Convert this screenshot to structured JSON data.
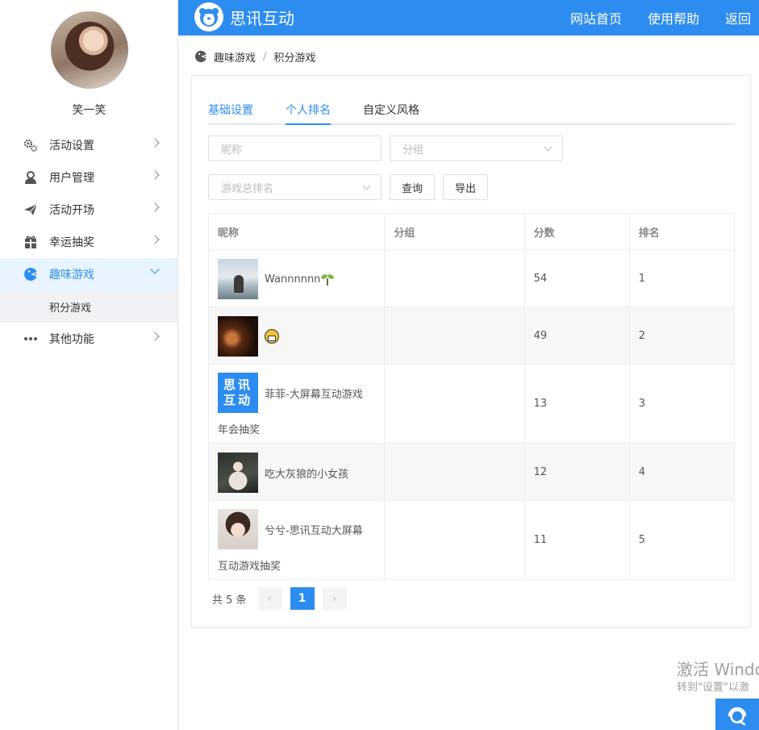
{
  "sidebar": {
    "username": "笑一笑",
    "menu": [
      {
        "label": "活动设置",
        "icon": "gears-icon"
      },
      {
        "label": "用户管理",
        "icon": "user-icon"
      },
      {
        "label": "活动开场",
        "icon": "paper-plane-icon"
      },
      {
        "label": "幸运抽奖",
        "icon": "gift-icon"
      },
      {
        "label": "趣味游戏",
        "icon": "game-icon"
      },
      {
        "label": "其他功能",
        "icon": "more-icon"
      }
    ],
    "submenu_active": "积分游戏"
  },
  "topbar": {
    "brand": "思讯互动",
    "nav": [
      "网站首页",
      "使用帮助",
      "返回"
    ],
    "accent": "#2d8cf0"
  },
  "breadcrumb": [
    "趣味游戏",
    "/",
    "积分游戏"
  ],
  "tabs": [
    "基础设置",
    "个人排名",
    "自定义风格"
  ],
  "filters": {
    "nickname_placeholder": "昵称",
    "group_placeholder": "分组",
    "rank_placeholder": "游戏总排名",
    "query_label": "查询",
    "export_label": "导出"
  },
  "table": {
    "columns": [
      "昵称",
      "分组",
      "分数",
      "排名"
    ],
    "rows": [
      {
        "nickname_line1": "Wannnnnn",
        "nickname_line2": "",
        "group": "",
        "score": "54",
        "rank": "1"
      },
      {
        "nickname_line1": "",
        "nickname_line2": "",
        "group": "",
        "score": "49",
        "rank": "2"
      },
      {
        "nickname_line1": "菲菲-大屏幕互动游戏",
        "nickname_line2": "年会抽奖",
        "group": "",
        "score": "13",
        "rank": "3",
        "avatar_text": "思讯互动"
      },
      {
        "nickname_line1": "吃大灰狼的小女孩",
        "nickname_line2": "",
        "group": "",
        "score": "12",
        "rank": "4"
      },
      {
        "nickname_line1": "兮兮-思讯互动大屏幕",
        "nickname_line2": "互动游戏抽奖",
        "group": "",
        "score": "11",
        "rank": "5"
      }
    ]
  },
  "pagination": {
    "total": "共 5 条",
    "prev": "‹",
    "current": "1",
    "next": "›"
  },
  "watermark": {
    "line1": "激活 Windo",
    "line2": "转到\"设置\"以激"
  }
}
